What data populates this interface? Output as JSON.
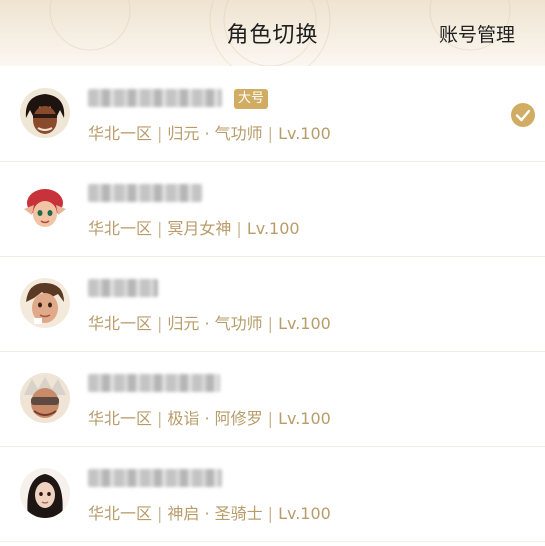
{
  "header": {
    "title": "角色切换",
    "account_manage": "账号管理"
  },
  "colors": {
    "accent": "#d1ad64",
    "info_text": "#b89c6a",
    "header_bg": "#f3eadc"
  },
  "characters": [
    {
      "server": "华北一区",
      "class": "归元 · 气功师",
      "level": "Lv.100",
      "badge": "大号",
      "selected": true,
      "avatar_icon": "character-avatar-icon"
    },
    {
      "server": "华北一区",
      "class": "冥月女神",
      "level": "Lv.100",
      "badge": "",
      "selected": false,
      "avatar_icon": "character-avatar-icon"
    },
    {
      "server": "华北一区",
      "class": "归元 · 气功师",
      "level": "Lv.100",
      "badge": "",
      "selected": false,
      "avatar_icon": "character-avatar-icon"
    },
    {
      "server": "华北一区",
      "class": "极诣 · 阿修罗",
      "level": "Lv.100",
      "badge": "",
      "selected": false,
      "avatar_icon": "character-avatar-icon"
    },
    {
      "server": "华北一区",
      "class": "神启 · 圣骑士",
      "level": "Lv.100",
      "badge": "",
      "selected": false,
      "avatar_icon": "character-avatar-icon"
    }
  ],
  "separator": "|"
}
